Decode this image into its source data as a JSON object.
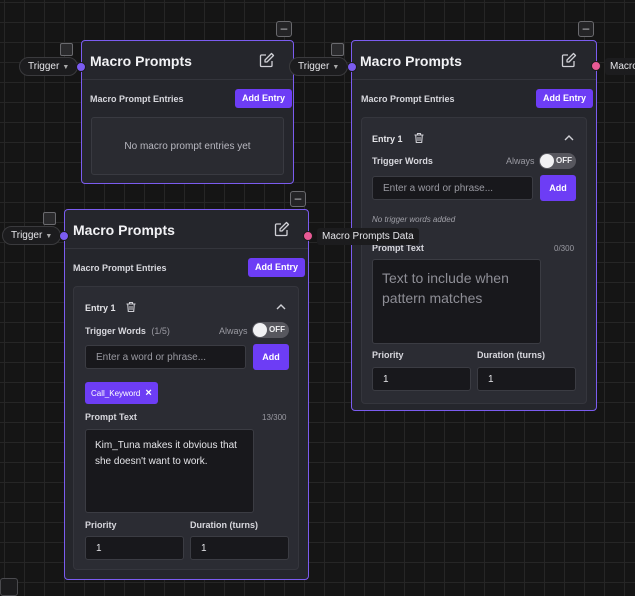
{
  "colors": {
    "accent": "#6d3df5",
    "node_border": "#7b5cf0",
    "output_handle": "#e85a95",
    "canvas": "#151515"
  },
  "nodes": [
    {
      "title": "Macro Prompts",
      "entries_label": "Macro Prompt Entries",
      "add_entry_label": "Add Entry",
      "empty_text": "No macro prompt entries yet",
      "input_pill_label": "Trigger"
    },
    {
      "title": "Macro Prompts",
      "entries_label": "Macro Prompt Entries",
      "add_entry_label": "Add Entry",
      "input_pill_label": "Trigger",
      "output_label": "Macro",
      "entry": {
        "title": "Entry 1",
        "trigger_words_label": "Trigger Words",
        "always_label": "Always",
        "toggle_label": "OFF",
        "word_placeholder": "Enter a word or phrase...",
        "add_label": "Add",
        "no_words_text": "No trigger words added",
        "prompt_text_label": "Prompt Text",
        "char_count": "0/300",
        "prompt_placeholder": "Text to include when pattern matches",
        "priority_label": "Priority",
        "priority_value": "1",
        "duration_label": "Duration (turns)",
        "duration_value": "1"
      }
    },
    {
      "title": "Macro Prompts",
      "entries_label": "Macro Prompt Entries",
      "add_entry_label": "Add Entry",
      "input_pill_label": "Trigger",
      "output_label": "Macro Prompts Data",
      "entry": {
        "title": "Entry 1",
        "trigger_words_label": "Trigger Words",
        "trigger_count": "(1/5)",
        "always_label": "Always",
        "toggle_label": "OFF",
        "word_placeholder": "Enter a word or phrase...",
        "add_label": "Add",
        "chip": "Call_Keyword",
        "prompt_text_label": "Prompt Text",
        "char_count": "13/300",
        "prompt_value": "Kim_Tuna makes it obvious that she doesn't want to work.",
        "priority_label": "Priority",
        "priority_value": "1",
        "duration_label": "Duration (turns)",
        "duration_value": "1"
      }
    }
  ]
}
